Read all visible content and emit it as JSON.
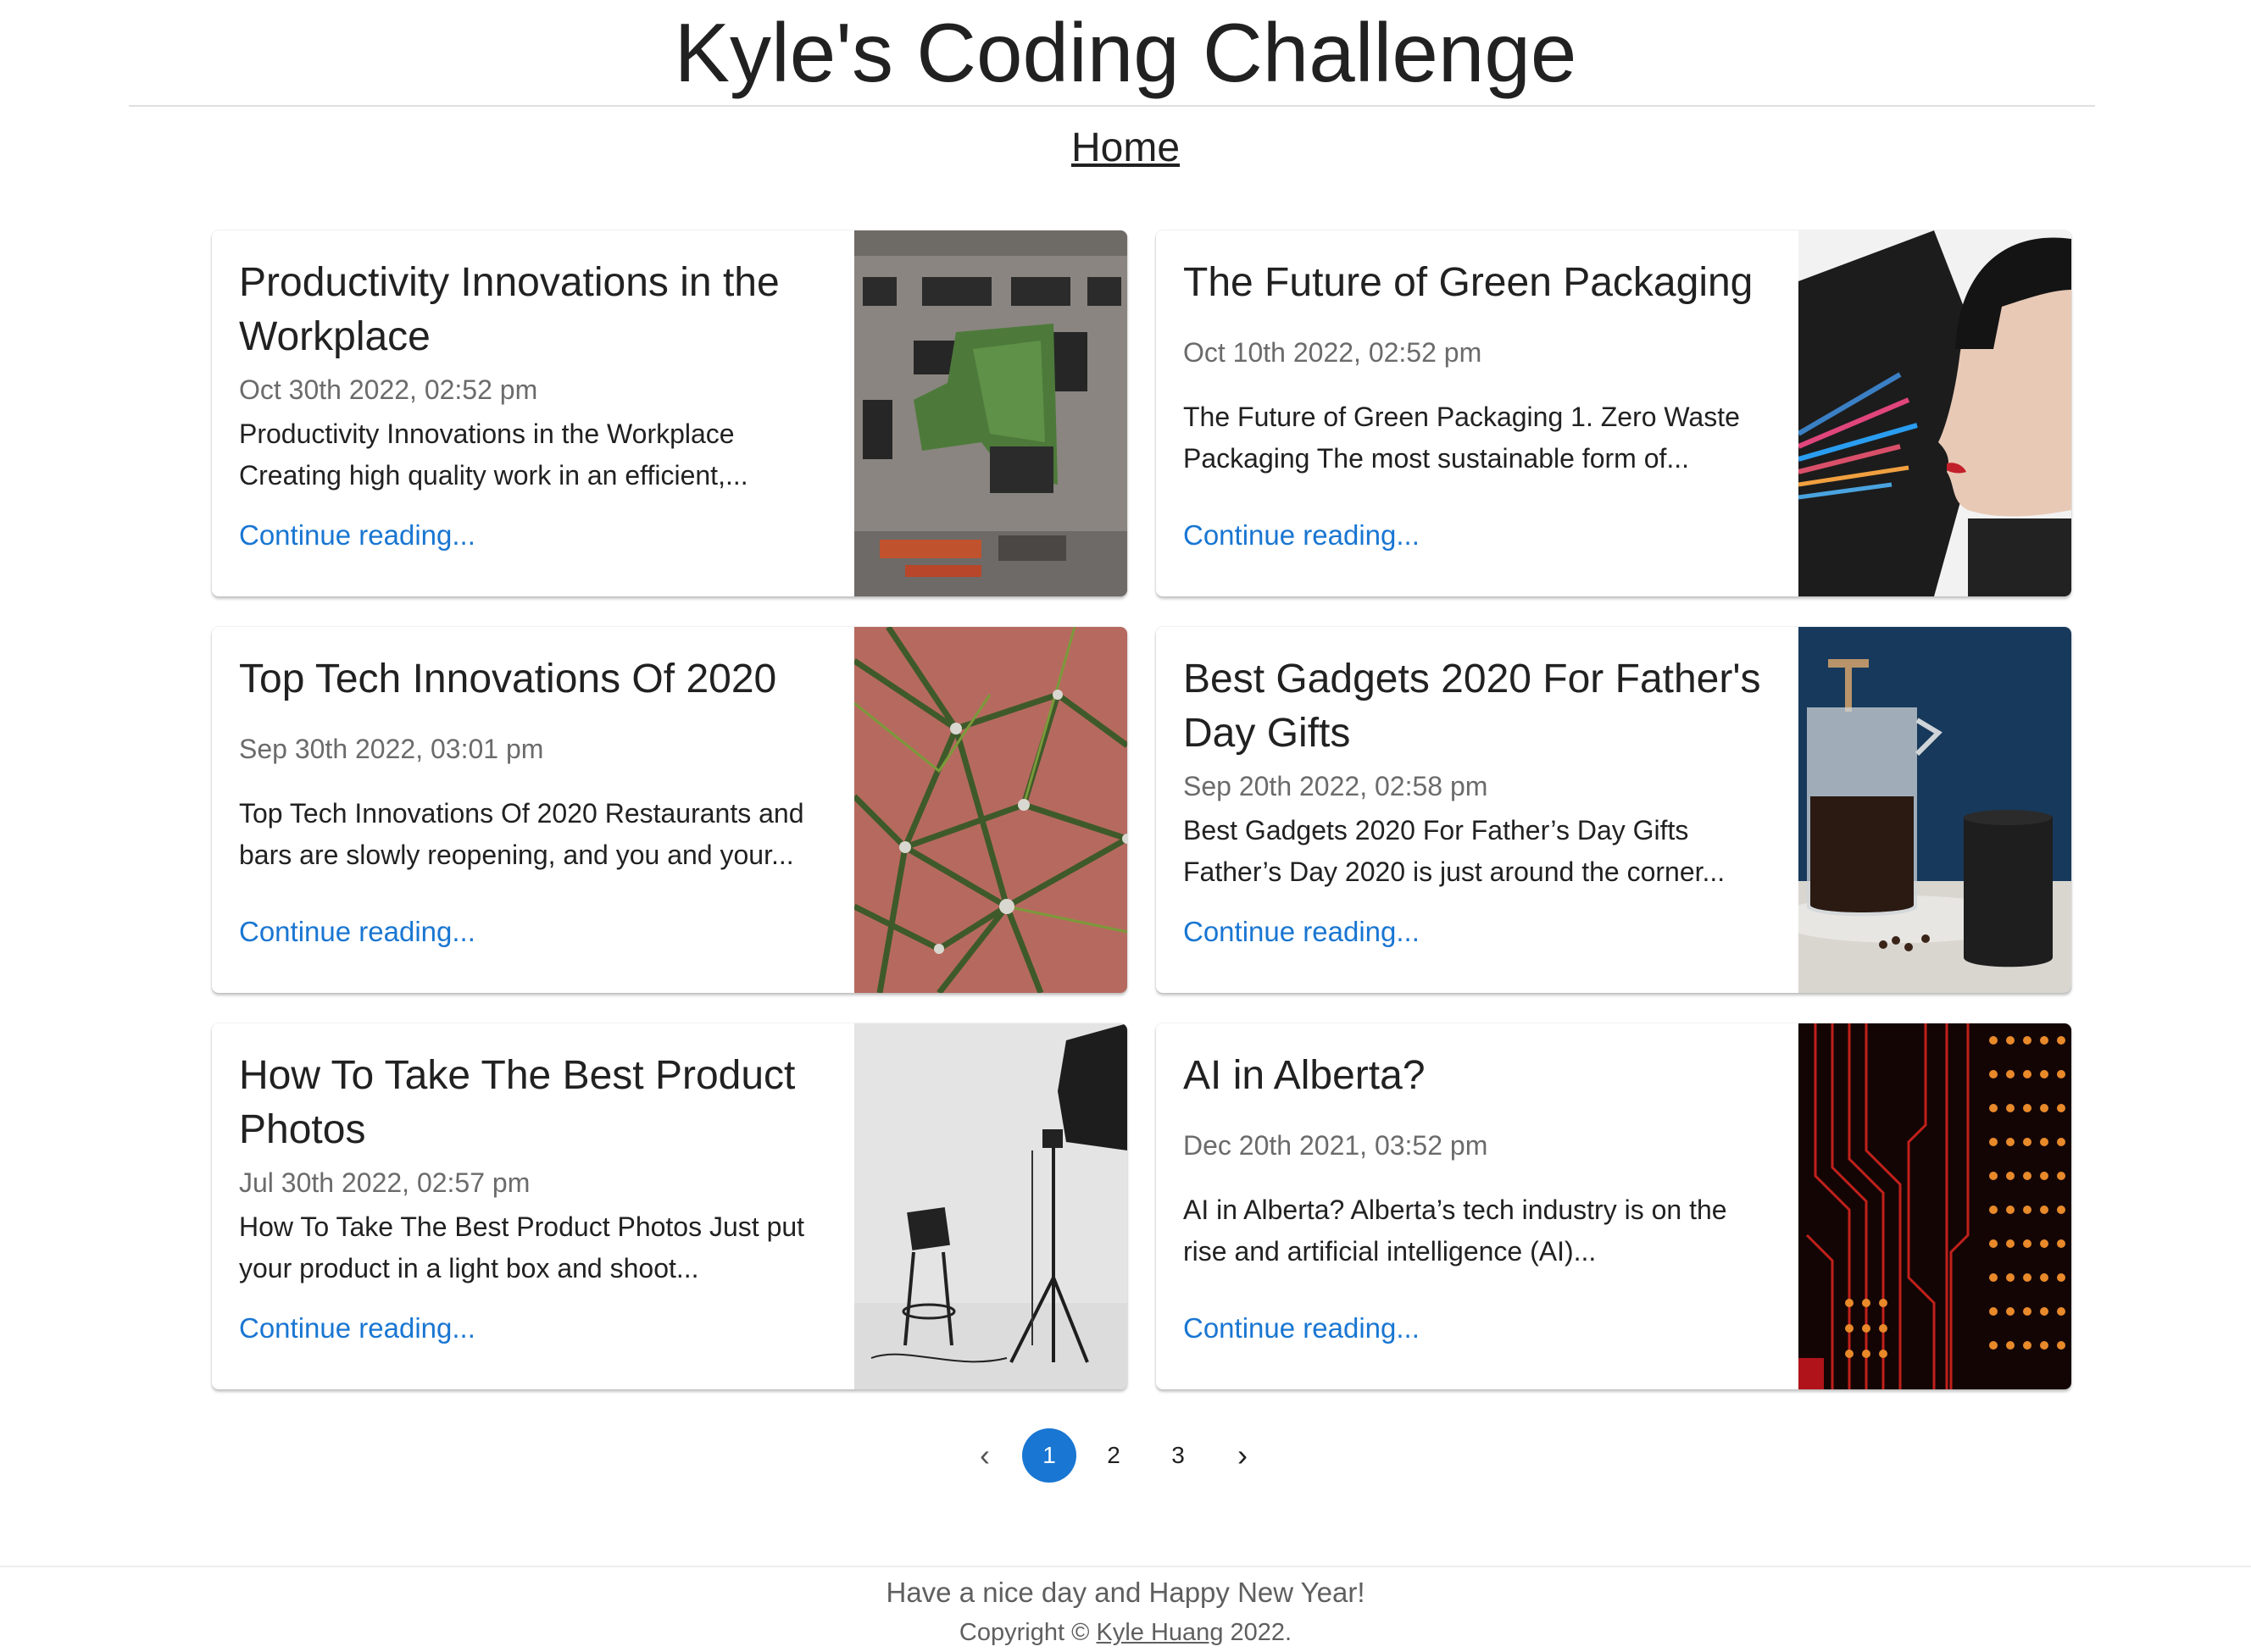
{
  "site": {
    "title": "Kyle's Coding Challenge"
  },
  "nav": {
    "home": "Home"
  },
  "posts": [
    {
      "title": "Productivity Innovations in the Workplace",
      "date": "Oct 30th 2022, 02:52 pm",
      "excerpt": "Productivity Innovations in the Workplace Creating high quality work in an efficient,...",
      "link": "Continue reading..."
    },
    {
      "title": "The Future of Green Packaging",
      "date": "Oct 10th 2022, 02:52 pm",
      "excerpt": "The Future of Green Packaging 1. Zero Waste Packaging The most sustainable form of...",
      "link": "Continue reading..."
    },
    {
      "title": "Top Tech Innovations Of 2020",
      "date": "Sep 30th 2022, 03:01 pm",
      "excerpt": "Top Tech Innovations Of 2020 Restaurants and bars are slowly reopening, and you and your...",
      "link": "Continue reading..."
    },
    {
      "title": "Best Gadgets 2020 For Father's Day Gifts",
      "date": "Sep 20th 2022, 02:58 pm",
      "excerpt": "Best Gadgets 2020 For Father’s Day Gifts Father’s Day 2020 is just around the corner...",
      "link": "Continue reading..."
    },
    {
      "title": "How To Take The Best Product Photos",
      "date": "Jul 30th 2022, 02:57 pm",
      "excerpt": "How To Take The Best Product Photos Just put your product in a light box and shoot...",
      "link": "Continue reading..."
    },
    {
      "title": "AI in Alberta?",
      "date": "Dec 20th 2021, 03:52 pm",
      "excerpt": "AI in Alberta? Alberta’s tech industry is on the rise and artificial intelligence (AI)...",
      "link": "Continue reading..."
    }
  ],
  "pagination": {
    "prev_icon": "chevron-left-icon",
    "pages": [
      "1",
      "2",
      "3"
    ],
    "current": "1",
    "next_icon": "chevron-right-icon"
  },
  "footer": {
    "message": "Have a nice day and Happy New Year!",
    "copyright_prefix": "Copyright ©",
    "author": "Kyle Huang",
    "copyright_suffix": "2022."
  },
  "colors": {
    "accent": "#1976d2",
    "text": "#212121",
    "muted": "#6b6b6b"
  }
}
